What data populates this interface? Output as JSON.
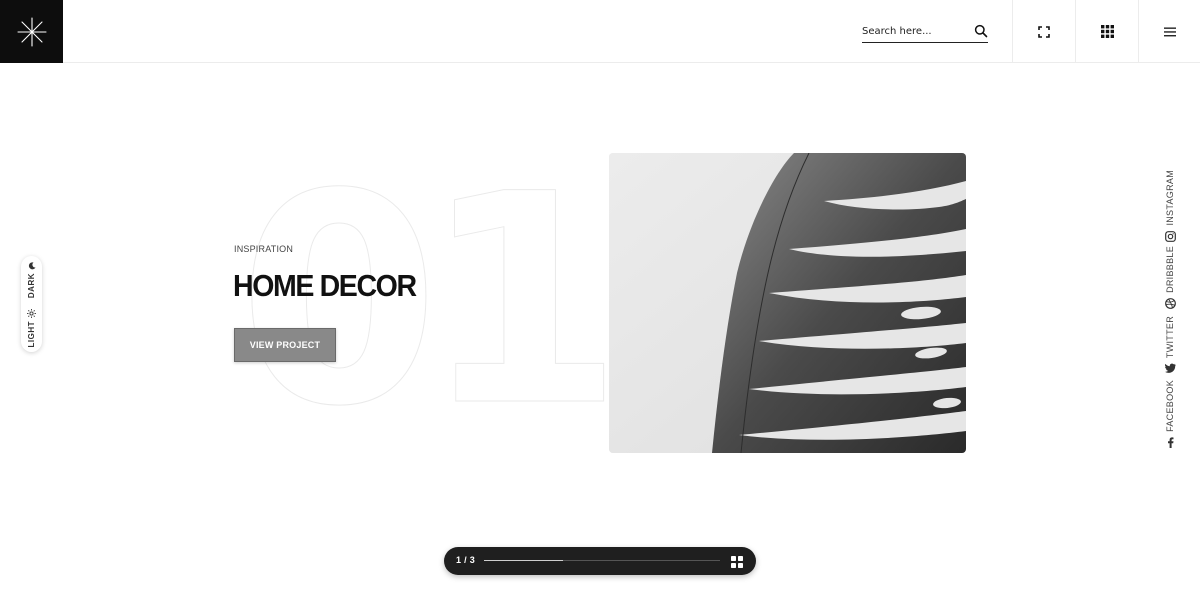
{
  "header": {
    "search_placeholder": "Search here...",
    "icons": [
      "logo-asterisk",
      "search-icon",
      "fullscreen-icon",
      "apps-grid-icon",
      "menu-icon"
    ]
  },
  "theme_switch": {
    "dark_label": "DARK",
    "light_label": "LIGHT"
  },
  "slide": {
    "number": "01",
    "category": "INSPIRATION",
    "title": "HOME DECOR",
    "button_label": "VIEW PROJECT",
    "image": "monstera-leaf-photo"
  },
  "social": [
    {
      "label": "INSTAGRAM",
      "icon": "instagram-icon"
    },
    {
      "label": "DRIBBBLE",
      "icon": "dribbble-icon"
    },
    {
      "label": "TWITTER",
      "icon": "twitter-icon"
    },
    {
      "label": "FACEBOOK",
      "icon": "facebook-icon"
    }
  ],
  "slider": {
    "counter": "1 / 3",
    "progress": 0.333
  },
  "colors": {
    "accent_dark": "#0d0d0d",
    "button_gray": "#898989",
    "bar_bg": "#1f1f1f"
  }
}
